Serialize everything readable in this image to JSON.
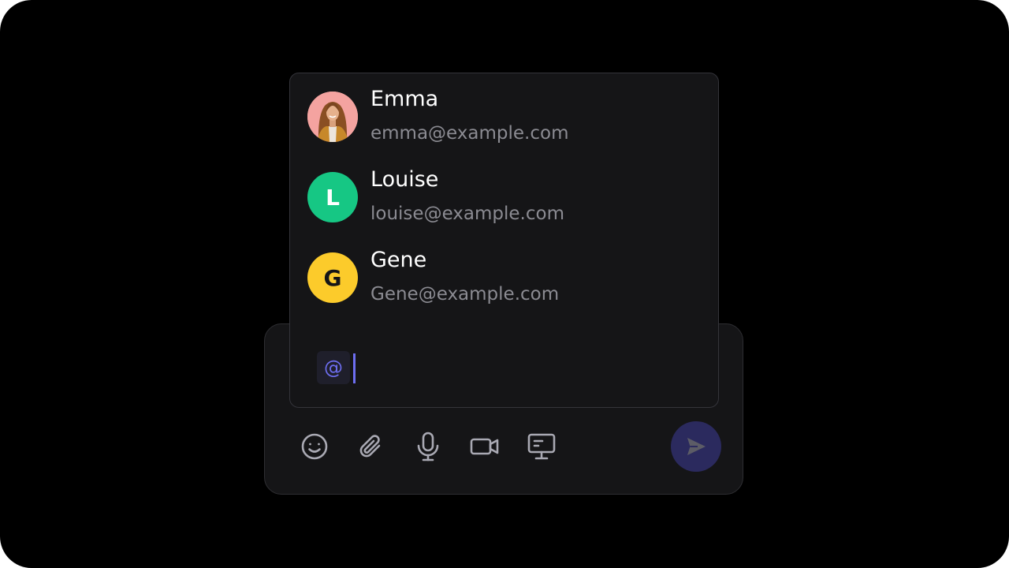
{
  "mentions": {
    "users": [
      {
        "name": "Emma",
        "email": "emma@example.com",
        "avatar_type": "photo",
        "avatar_color": "#f4a3a0"
      },
      {
        "name": "Louise",
        "email": "louise@example.com",
        "avatar_initial": "L",
        "avatar_color": "#16c784",
        "initial_color": "#ffffff"
      },
      {
        "name": "Gene",
        "email": "Gene@example.com",
        "avatar_initial": "G",
        "avatar_color": "#fccb2b",
        "initial_color": "#151517"
      }
    ]
  },
  "input": {
    "mention_symbol": "@"
  },
  "toolbar": {
    "icons": [
      "emoji-icon",
      "paperclip-icon",
      "microphone-icon",
      "video-camera-icon",
      "screen-share-icon"
    ]
  },
  "colors": {
    "accent": "#6d6ef0",
    "panel_bg": "#151517",
    "send_button_bg": "#2b2a5e"
  }
}
